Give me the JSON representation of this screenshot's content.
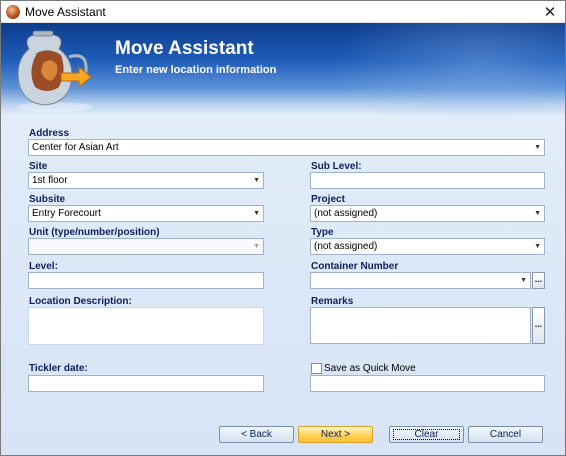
{
  "window": {
    "title": "Move Assistant",
    "close_glyph": "✕"
  },
  "banner": {
    "heading": "Move Assistant",
    "subheading": "Enter new location information"
  },
  "form": {
    "address": {
      "label": "Address",
      "value": "Center for Asian Art"
    },
    "site": {
      "label": "Site",
      "value": "1st floor"
    },
    "sub_level": {
      "label": "Sub Level:",
      "value": ""
    },
    "subsite": {
      "label": "Subsite",
      "value": "Entry Forecourt"
    },
    "project": {
      "label": "Project",
      "value": "(not assigned)"
    },
    "unit": {
      "label": "Unit (type/number/position)",
      "value": ""
    },
    "type": {
      "label": "Type",
      "value": "(not assigned)"
    },
    "level": {
      "label": "Level:",
      "value": ""
    },
    "container_number": {
      "label": "Container Number",
      "value": "",
      "browse_glyph": "..."
    },
    "location_description": {
      "label": "Location Description:",
      "value": ""
    },
    "remarks": {
      "label": "Remarks",
      "value": "",
      "browse_glyph": "..."
    },
    "tickler_date": {
      "label": "Tickler date:",
      "value": ""
    },
    "quick_move": {
      "label": "Save as Quick Move",
      "checked": false,
      "name_value": ""
    }
  },
  "buttons": {
    "back": "< Back",
    "next": "Next >",
    "clear": "Clear",
    "cancel": "Cancel"
  },
  "icons": {
    "dropdown": "▼"
  },
  "colors": {
    "label": "#0d1f5e",
    "banner_top": "#0d3c8c",
    "primary_button": "#ffd25a"
  }
}
